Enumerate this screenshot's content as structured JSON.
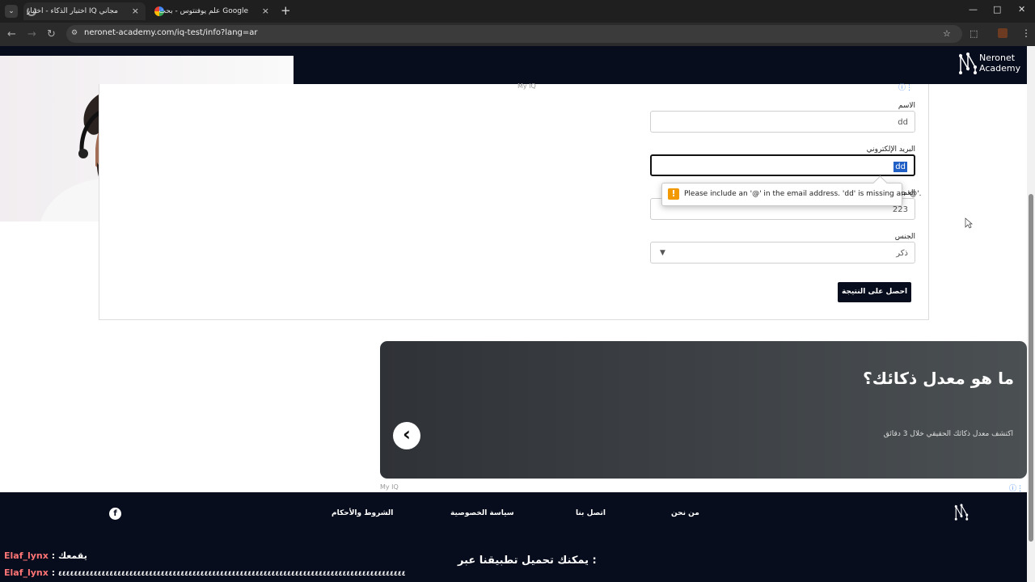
{
  "browser": {
    "tabs": [
      {
        "title": "اختبار الذكاء - اختبار IQ مجاني",
        "active": true
      },
      {
        "title": "علم يوفنتوس - بحث Google",
        "active": false
      }
    ],
    "new_tab": "+",
    "url": "neronet-academy.com/iq-test/info?lang=ar",
    "window_controls": {
      "minimize": "—",
      "restore": "□",
      "close": "✕"
    },
    "nav_icons": {
      "back": "←",
      "forward": "→",
      "reload": "↻"
    },
    "tab_close": "×"
  },
  "site": {
    "logo": {
      "line1": "Neronet",
      "line2": "Academy"
    },
    "myiq_label": "My IQ",
    "form": {
      "name_label": "الاسم",
      "name_value": "dd",
      "email_label": "البريد الإلكتروني",
      "email_value": "dd",
      "age_label": "العمر",
      "age_value": "223",
      "gender_label": "الجنس",
      "gender_value": "ذكر",
      "submit": "احصل على النتيجة"
    },
    "validation_message": "Please include an '@' in the email address. 'dd' is missing an '@'.",
    "promo": {
      "title": "ما هو معدل ذكائك؟",
      "subtitle": "اكتشف معدل ذكائك الحقيقي خلال 3 دقائق"
    },
    "footer": {
      "links": [
        "من نحن",
        "اتصل بنا",
        "سياسة الخصوصية",
        "الشروط والأحكام"
      ],
      "app_download": "يمكنك تحميل تطبيقنا عبر :"
    }
  },
  "chat": [
    {
      "user": "Elaf_lynx",
      "message": "يقمعك"
    },
    {
      "user": "Elaf_lynx",
      "message": "٤٤٤٤٤٤٤٤٤٤٤٤٤٤٤٤٤٤٤٤٤٤٤٤٤٤٤٤٤٤٤٤٤٤٤٤٤٤٤٤٤٤٤٤٤٤٤٤٤٤٤٤٤٤٤٤٤٤٤٤٤٤٤٤٤٤٤٤٤٤٤٤٤٤٤٤٤٤٤٤٤٤٤٤٤٤٤٤"
    }
  ]
}
